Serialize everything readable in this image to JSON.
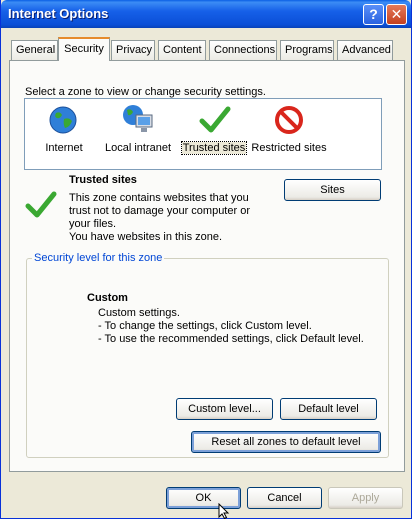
{
  "window": {
    "title": "Internet Options"
  },
  "titlebar": {
    "help_label": "?",
    "close_label": "✕"
  },
  "tabs": [
    {
      "label": "General"
    },
    {
      "label": "Security"
    },
    {
      "label": "Privacy"
    },
    {
      "label": "Content"
    },
    {
      "label": "Connections"
    },
    {
      "label": "Programs"
    },
    {
      "label": "Advanced"
    }
  ],
  "security": {
    "instruction": "Select a zone to view or change security settings.",
    "zones": [
      {
        "label": "Internet",
        "icon": "globe-icon"
      },
      {
        "label": "Local intranet",
        "icon": "intranet-icon"
      },
      {
        "label": "Trusted sites",
        "icon": "checkmark-icon",
        "selected": true
      },
      {
        "label": "Restricted sites",
        "icon": "restricted-icon"
      }
    ],
    "zone_detail": {
      "name": "Trusted sites",
      "line1": "This zone contains websites that you",
      "line2": "trust not to damage your computer or",
      "line3": "your files.",
      "line4": "You have websites in this zone."
    },
    "sites_button": "Sites",
    "group_title": "Security level for this zone",
    "level": {
      "name": "Custom",
      "line1": "Custom settings.",
      "line2": "- To change the settings, click Custom level.",
      "line3": "- To use the recommended settings, click Default level."
    },
    "custom_level_button": "Custom level...",
    "default_level_button": "Default level",
    "reset_button": "Reset all zones to default level"
  },
  "footer": {
    "ok": "OK",
    "cancel": "Cancel",
    "apply": "Apply"
  },
  "colors": {
    "title_blue": "#0b4fd7",
    "active_tab_orange": "#e68b2c",
    "group_title_blue": "#0046d5",
    "check_green": "#3aa832",
    "restricted_red": "#d9261c"
  }
}
